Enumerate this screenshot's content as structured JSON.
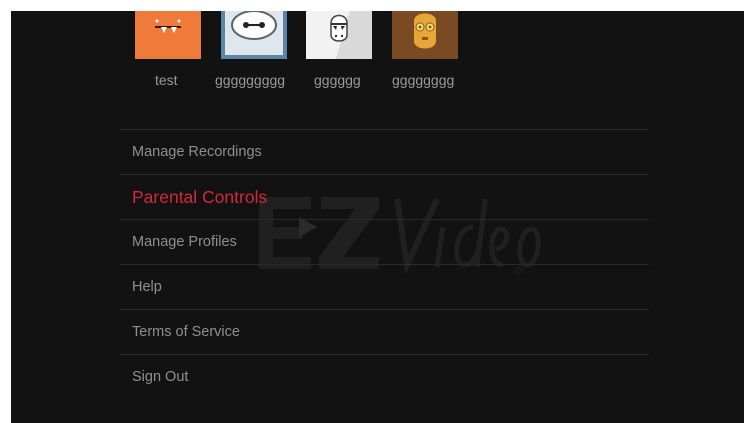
{
  "profiles": [
    {
      "name": "test",
      "icon": "orange-monster-avatar-icon",
      "color": "#f07a3a"
    },
    {
      "name": "ggggggggg",
      "icon": "robot-face-avatar-icon",
      "color": "#5a85a8"
    },
    {
      "name": "gggggg",
      "icon": "stormtrooper-avatar-icon",
      "color": "#f2f2f2"
    },
    {
      "name": "gggggggg",
      "icon": "golden-droid-avatar-icon",
      "color": "#7a4a22"
    }
  ],
  "menu": {
    "items": [
      {
        "label": "Manage Recordings"
      },
      {
        "label": "Parental Controls",
        "active": true
      },
      {
        "label": "Manage Profiles"
      },
      {
        "label": "Help"
      },
      {
        "label": "Terms of Service"
      },
      {
        "label": "Sign Out"
      }
    ]
  },
  "watermark": {
    "brand": "EZVideo"
  },
  "colors": {
    "background": "#121212",
    "accent": "#d6263b",
    "text": "#8f8f8f",
    "divider": "#2a2a2a"
  }
}
